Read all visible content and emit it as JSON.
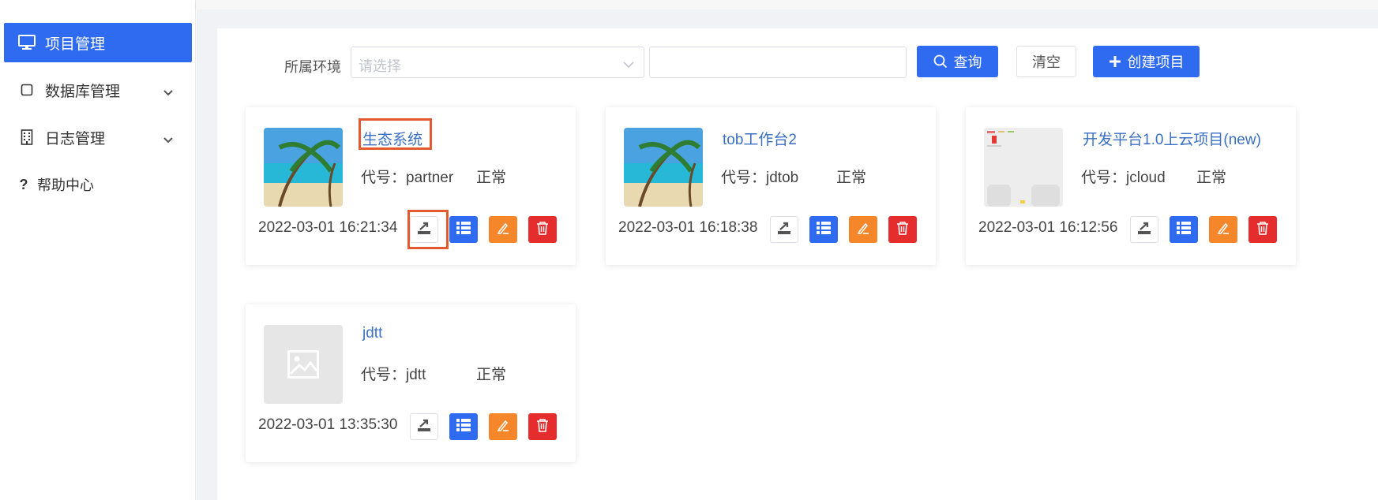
{
  "sidebar": {
    "items": [
      {
        "label": "项目管理",
        "icon": "monitor-icon",
        "active": true
      },
      {
        "label": "数据库管理",
        "icon": "square-icon",
        "has_children": true
      },
      {
        "label": "日志管理",
        "icon": "building-icon",
        "has_children": true
      },
      {
        "label": "帮助中心",
        "icon": "question-icon"
      }
    ]
  },
  "toolbar": {
    "env_label": "所属环境",
    "env_placeholder": "请选择",
    "search_value": "",
    "query_label": "查询",
    "clear_label": "清空",
    "create_label": "创建项目"
  },
  "projects": [
    {
      "name": "生态系统",
      "code": "代号：partner",
      "status": "正常",
      "time": "2022-03-01 16:21:34",
      "thumb": "beach-image"
    },
    {
      "name": "tob工作台2",
      "code": "代号：jdtob",
      "status": "正常",
      "time": "2022-03-01 16:18:38",
      "thumb": "beach-image"
    },
    {
      "name": "开发平台1.0上云项目(new)",
      "code": "代号：jcloud",
      "status": "正常",
      "time": "2022-03-01 16:12:56",
      "thumb": "screenshot-image"
    },
    {
      "name": "jdtt",
      "code": "代号：jdtt",
      "status": "正常",
      "time": "2022-03-01 13:35:30",
      "thumb": "placeholder-image-icon"
    }
  ],
  "colors": {
    "primary": "#2f6bf0",
    "warning": "#f5862a",
    "danger": "#e52d2d",
    "link": "#3a6fc4",
    "highlight": "#e25a2e"
  }
}
